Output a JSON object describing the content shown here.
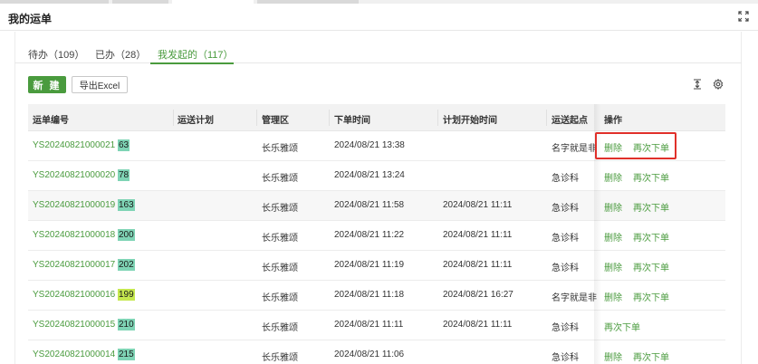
{
  "window": {
    "title": "我的运单"
  },
  "tabs": [
    {
      "label": "待办（109）"
    },
    {
      "label": "已办（28）"
    },
    {
      "label": "我发起的（117）"
    }
  ],
  "toolbar": {
    "new_label": "新 建",
    "export_label": "导出Excel"
  },
  "table": {
    "columns": [
      "运单编号",
      "运送计划",
      "管理区",
      "下单时间",
      "计划开始时间",
      "运送起点",
      "操作"
    ],
    "rows": [
      {
        "id": "YS20240821000021",
        "suffix": "63",
        "plan": "",
        "area": "长乐雅颂",
        "order_time": "2024/08/21 13:38",
        "plan_start": "",
        "origin": "名字就是非常",
        "actions": [
          "删除",
          "再次下单"
        ]
      },
      {
        "id": "YS20240821000020",
        "suffix": "78",
        "plan": "",
        "area": "长乐雅颂",
        "order_time": "2024/08/21 13:24",
        "plan_start": "",
        "origin": "急诊科",
        "actions": [
          "删除",
          "再次下单"
        ]
      },
      {
        "id": "YS20240821000019",
        "suffix": "163",
        "plan": "",
        "area": "长乐雅颂",
        "order_time": "2024/08/21 11:58",
        "plan_start": "2024/08/21 11:11",
        "origin": "急诊科",
        "actions": [
          "删除",
          "再次下单"
        ]
      },
      {
        "id": "YS20240821000018",
        "suffix": "200",
        "plan": "",
        "area": "长乐雅颂",
        "order_time": "2024/08/21 11:22",
        "plan_start": "2024/08/21 11:11",
        "origin": "急诊科",
        "actions": [
          "删除",
          "再次下单"
        ]
      },
      {
        "id": "YS20240821000017",
        "suffix": "202",
        "plan": "",
        "area": "长乐雅颂",
        "order_time": "2024/08/21 11:19",
        "plan_start": "2024/08/21 11:11",
        "origin": "急诊科",
        "actions": [
          "删除",
          "再次下单"
        ]
      },
      {
        "id": "YS20240821000016",
        "suffix": "199",
        "plan": "",
        "area": "长乐雅颂",
        "order_time": "2024/08/21 11:18",
        "plan_start": "2024/08/21 16:27",
        "origin": "名字就是非常",
        "actions": [
          "删除",
          "再次下单"
        ]
      },
      {
        "id": "YS20240821000015",
        "suffix": "210",
        "plan": "",
        "area": "长乐雅颂",
        "order_time": "2024/08/21 11:11",
        "plan_start": "2024/08/21 11:11",
        "origin": "急诊科",
        "actions": [
          "再次下单"
        ]
      },
      {
        "id": "YS20240821000014",
        "suffix": "215",
        "plan": "",
        "area": "长乐雅颂",
        "order_time": "2024/08/21 11:06",
        "plan_start": "",
        "origin": "急诊科",
        "actions": [
          "删除",
          "再次下单"
        ]
      }
    ]
  },
  "colors": {
    "accent": "#4a9b3e",
    "highlight": "#7fd4b5",
    "highlight_alt": "#c5e84f",
    "annotation_box": "#e0302a"
  },
  "icons": {
    "expand": "expand-icon",
    "column_height": "column-height-icon",
    "settings": "gear-icon"
  }
}
